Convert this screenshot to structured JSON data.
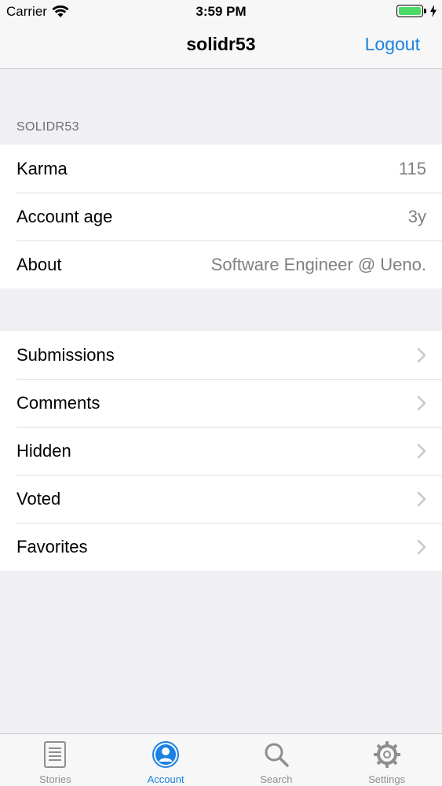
{
  "status_bar": {
    "carrier": "Carrier",
    "time": "3:59 PM",
    "battery_level": 1.0
  },
  "nav": {
    "title": "solidr53",
    "logout_label": "Logout"
  },
  "profile_section": {
    "header": "SOLIDR53",
    "rows": [
      {
        "label": "Karma",
        "value": "115"
      },
      {
        "label": "Account age",
        "value": "3y"
      },
      {
        "label": "About",
        "value": "Software Engineer @ Ueno."
      }
    ]
  },
  "links_section": {
    "rows": [
      {
        "label": "Submissions"
      },
      {
        "label": "Comments"
      },
      {
        "label": "Hidden"
      },
      {
        "label": "Voted"
      },
      {
        "label": "Favorites"
      }
    ]
  },
  "tab_bar": {
    "tabs": [
      {
        "label": "Stories",
        "icon": "stories-icon",
        "active": false
      },
      {
        "label": "Account",
        "icon": "account-icon",
        "active": true
      },
      {
        "label": "Search",
        "icon": "search-icon",
        "active": false
      },
      {
        "label": "Settings",
        "icon": "gear-icon",
        "active": false
      }
    ]
  },
  "colors": {
    "accent": "#1a82e2",
    "background": "#efeff4",
    "battery": "#4cd964",
    "secondary_text": "#808080"
  }
}
